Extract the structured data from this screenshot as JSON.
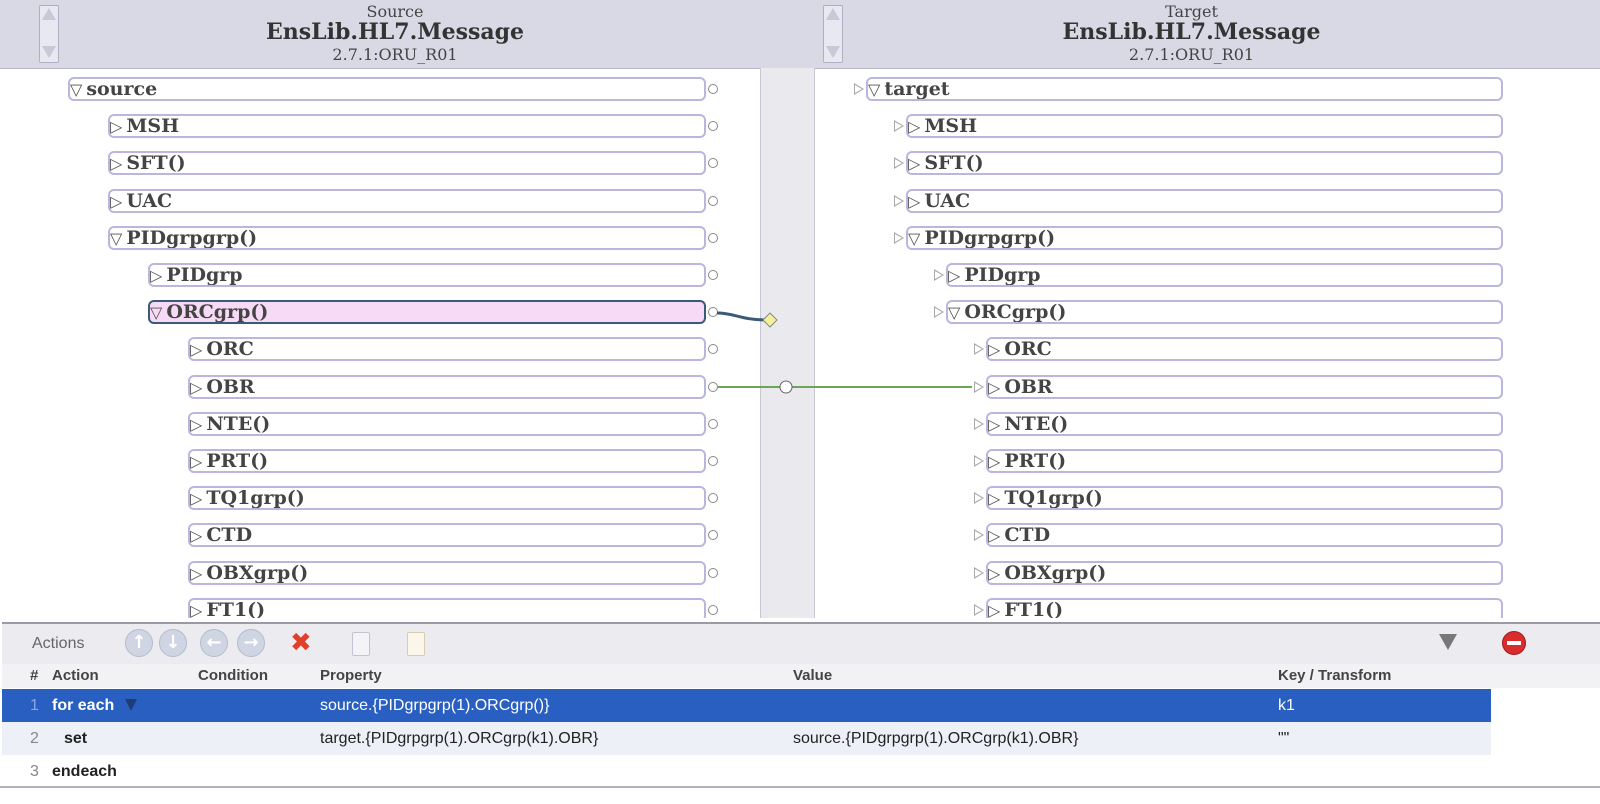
{
  "source_header": {
    "label": "Source",
    "class_name": "EnsLib.HL7.Message",
    "doc_type": "2.7.1:ORU_R01"
  },
  "target_header": {
    "label": "Target",
    "class_name": "EnsLib.HL7.Message",
    "doc_type": "2.7.1:ORU_R01"
  },
  "source_tree": [
    {
      "label": "source",
      "expanded": true
    },
    {
      "label": "MSH",
      "expanded": false
    },
    {
      "label": "SFT()",
      "expanded": false
    },
    {
      "label": "UAC",
      "expanded": false
    },
    {
      "label": "PIDgrpgrp()",
      "expanded": true
    },
    {
      "label": "PIDgrp",
      "expanded": false
    },
    {
      "label": "ORCgrp()",
      "expanded": true,
      "selected": true
    },
    {
      "label": "ORC",
      "expanded": false
    },
    {
      "label": "OBR",
      "expanded": false
    },
    {
      "label": "NTE()",
      "expanded": false
    },
    {
      "label": "PRT()",
      "expanded": false
    },
    {
      "label": "TQ1grp()",
      "expanded": false
    },
    {
      "label": "CTD",
      "expanded": false
    },
    {
      "label": "OBXgrp()",
      "expanded": false
    },
    {
      "label": "FT1()",
      "expanded": false
    }
  ],
  "target_tree": [
    {
      "label": "target",
      "expanded": true
    },
    {
      "label": "MSH",
      "expanded": false
    },
    {
      "label": "SFT()",
      "expanded": false
    },
    {
      "label": "UAC",
      "expanded": false
    },
    {
      "label": "PIDgrpgrp()",
      "expanded": true
    },
    {
      "label": "PIDgrp",
      "expanded": false
    },
    {
      "label": "ORCgrp()",
      "expanded": true
    },
    {
      "label": "ORC",
      "expanded": false
    },
    {
      "label": "OBR",
      "expanded": false
    },
    {
      "label": "NTE()",
      "expanded": false
    },
    {
      "label": "PRT()",
      "expanded": false
    },
    {
      "label": "TQ1grp()",
      "expanded": false
    },
    {
      "label": "CTD",
      "expanded": false
    },
    {
      "label": "OBXgrp()",
      "expanded": false
    },
    {
      "label": "FT1()",
      "expanded": false
    }
  ],
  "actions": {
    "title": "Actions",
    "toolbar_icons": [
      "move-up-icon",
      "move-down-icon",
      "move-left-icon",
      "move-right-icon",
      "delete-icon",
      "copy-icon",
      "paste-icon",
      "filter-icon",
      "remove-icon"
    ]
  },
  "table": {
    "headers": {
      "num": "#",
      "action": "Action",
      "condition": "Condition",
      "property": "Property",
      "value": "Value",
      "key": "Key / Transform"
    },
    "rows": [
      {
        "num": "1",
        "action": "for each",
        "condition": "",
        "property": "source.{PIDgrpgrp(1).ORCgrp()}",
        "value": "",
        "key": "k1"
      },
      {
        "num": "2",
        "action": "set",
        "condition": "",
        "property": "target.{PIDgrpgrp(1).ORCgrp(k1).OBR}",
        "value": "source.{PIDgrpgrp(1).ORCgrp(k1).OBR}",
        "key": "\"\""
      },
      {
        "num": "3",
        "action": "endeach",
        "condition": "",
        "property": "",
        "value": "",
        "key": ""
      }
    ]
  },
  "colors": {
    "header_bg": "#d9d9e6",
    "node_border": "#b9b6e0",
    "selected_node": "#f6daf6",
    "link_green": "#6aa55a",
    "link_blue": "#3a5a78",
    "row_selected": "#2a5fc2"
  }
}
